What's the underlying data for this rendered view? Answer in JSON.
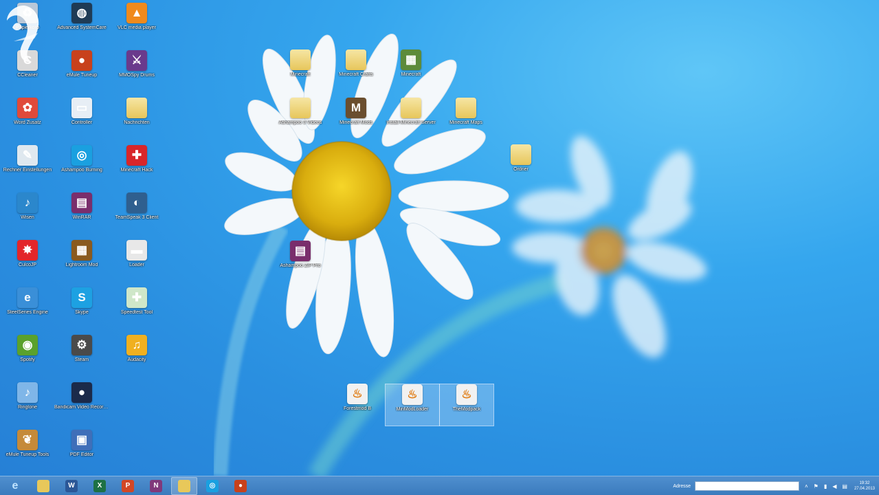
{
  "desktop": {
    "left_icons": [
      {
        "label": "Papierkorb",
        "icon": "recycle-bin-icon",
        "color": "#b9c8d8"
      },
      {
        "label": "Advanced SystemCare",
        "icon": "systemcare-icon",
        "color": "#1f3b55"
      },
      {
        "label": "VLC media player",
        "icon": "vlc-icon",
        "color": "#f08a1c"
      },
      {
        "label": "CCleaner",
        "icon": "ccleaner-icon",
        "color": "#d9d9d9"
      },
      {
        "label": "eMule Tuneup",
        "icon": "emule-icon",
        "color": "#c8411c"
      },
      {
        "label": "MMOSpy Drums",
        "icon": "mmo-icon",
        "color": "#6a3a8c"
      },
      {
        "label": "Word Zusatz",
        "icon": "paint-icon",
        "color": "#e04a3a"
      },
      {
        "label": "Controller",
        "icon": "controller-icon",
        "color": "#e7eef5"
      },
      {
        "label": "Nachrichten",
        "icon": "folder-icon",
        "color": "#ead37a"
      },
      {
        "label": "Rechner Einstellungen",
        "icon": "settings-doc-icon",
        "color": "#dfe8ef"
      },
      {
        "label": "Ashampoo Burning",
        "icon": "media-icon",
        "color": "#1aa0e0"
      },
      {
        "label": "Minecraft Hack",
        "icon": "puzzle-icon",
        "color": "#d8262a"
      },
      {
        "label": "Wisen",
        "icon": "itunes-icon",
        "color": "#2b87cc"
      },
      {
        "label": "WinRAR",
        "icon": "winrar-icon",
        "color": "#7a2e6c"
      },
      {
        "label": "TeamSpeak 3 Client",
        "icon": "teamspeak-icon",
        "color": "#2f5f8f"
      },
      {
        "label": "CulcoJP",
        "icon": "splat-icon",
        "color": "#e3262a"
      },
      {
        "label": "Lightroom Mod",
        "icon": "gallery-icon",
        "color": "#8a5a1e"
      },
      {
        "label": "Loader",
        "icon": "truck-icon",
        "color": "#e8e8e8"
      },
      {
        "label": "SteelSeries Engine",
        "icon": "ie-icon",
        "color": "#3a8fd8"
      },
      {
        "label": "Skype",
        "icon": "skype-icon",
        "color": "#1da1e2"
      },
      {
        "label": "Speedtest Tool",
        "icon": "spray-icon",
        "color": "#cfe7c9"
      },
      {
        "label": "Spotify",
        "icon": "spotify-icon",
        "color": "#5aa12c"
      },
      {
        "label": "Steam",
        "icon": "steam-icon",
        "color": "#4a4a4a"
      },
      {
        "label": "Audacity",
        "icon": "audacity-icon",
        "color": "#f0b020"
      },
      {
        "label": "Ringtone",
        "icon": "note-icon",
        "color": "#7fb6e8"
      },
      {
        "label": "Bandicam Video Recorder",
        "icon": "record-icon",
        "color": "#1b2a4a"
      },
      {
        "label": "",
        "icon": "blank-icon",
        "color": "transparent"
      },
      {
        "label": "eMule Tuneup Tools",
        "icon": "fish-icon",
        "color": "#c58a3a"
      },
      {
        "label": "PDF Editor",
        "icon": "pc-icon",
        "color": "#3f6fb9"
      }
    ],
    "flower_icons": [
      {
        "label": "Minecraft",
        "icon": "folder-icon",
        "color": "#ead37a"
      },
      {
        "label": "Minecraft Crafts",
        "icon": "folder-icon",
        "color": "#ead37a"
      },
      {
        "label": "Minecraft",
        "icon": "minecraft-icon",
        "color": "#5d8b3a"
      },
      {
        "label": "Ashampoo 3 Videos",
        "icon": "folder-icon",
        "color": "#ead37a"
      },
      {
        "label": "Minecraft Mods",
        "icon": "minecraft-m-icon",
        "color": "#6a4e2e"
      },
      {
        "label": "Install Minecraft Server",
        "icon": "folder-icon",
        "color": "#ead37a"
      },
      {
        "label": "Minecraft Maps",
        "icon": "folder-icon",
        "color": "#ead37a"
      },
      {
        "label": "Ordner",
        "icon": "folder-icon",
        "color": "#ead37a"
      },
      {
        "label": "Ashampoo ZIP Pro",
        "icon": "winrar-icon",
        "color": "#7a2e6c"
      }
    ],
    "java_icons": [
      {
        "label": "Forestmod B",
        "icon": "java-icon",
        "selected": false
      },
      {
        "label": "MinModLoader",
        "icon": "java-icon",
        "selected": true
      },
      {
        "label": "TheModpack",
        "icon": "java-icon",
        "selected": true
      }
    ]
  },
  "taskbar": {
    "apps": [
      {
        "name": "Internet Explorer",
        "icon": "ie-icon",
        "color": "#2f8fd8",
        "glyph": "e",
        "active": false
      },
      {
        "name": "File Explorer",
        "icon": "folder-icon",
        "color": "#e8c85a",
        "glyph": "",
        "active": false
      },
      {
        "name": "Word",
        "icon": "word-icon",
        "color": "#2b5797",
        "glyph": "W",
        "active": false
      },
      {
        "name": "Excel",
        "icon": "excel-icon",
        "color": "#1e7145",
        "glyph": "X",
        "active": false
      },
      {
        "name": "PowerPoint",
        "icon": "powerpoint-icon",
        "color": "#d24726",
        "glyph": "P",
        "active": false
      },
      {
        "name": "OneNote",
        "icon": "onenote-icon",
        "color": "#80397b",
        "glyph": "N",
        "active": false
      },
      {
        "name": "Explorer Window",
        "icon": "folder-icon",
        "color": "#e8c85a",
        "glyph": "",
        "active": true
      },
      {
        "name": "Media Player",
        "icon": "media-icon",
        "color": "#1aa0e0",
        "glyph": "◎",
        "active": false
      },
      {
        "name": "eMule",
        "icon": "emule-icon",
        "color": "#c8411c",
        "glyph": "●",
        "active": false
      }
    ],
    "address_label": "Adresse",
    "address_value": "",
    "clock_time": "19:32",
    "clock_date": "27.04.2013"
  }
}
